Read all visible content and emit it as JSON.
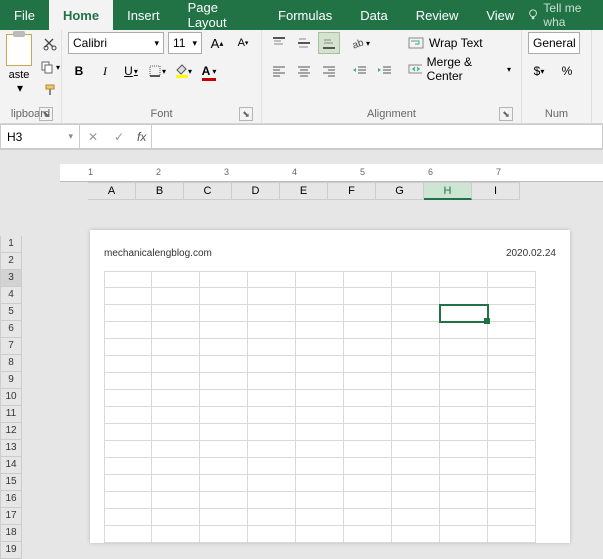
{
  "tabs": {
    "file": "File",
    "home": "Home",
    "insert": "Insert",
    "page_layout": "Page Layout",
    "formulas": "Formulas",
    "data": "Data",
    "review": "Review",
    "view": "View",
    "tellme": "Tell me wha"
  },
  "ribbon": {
    "clipboard": {
      "label": "lipboard",
      "paste": "aste"
    },
    "font": {
      "label": "Font",
      "name": "Calibri",
      "size": "11"
    },
    "alignment": {
      "label": "Alignment",
      "wrap": "Wrap Text",
      "merge": "Merge & Center"
    },
    "number": {
      "label": "Num",
      "format": "General",
      "currency": "$",
      "percent": "%"
    }
  },
  "formula_bar": {
    "name_box": "H3",
    "fx": "fx",
    "value": ""
  },
  "sheet": {
    "columns": [
      "A",
      "B",
      "C",
      "D",
      "E",
      "F",
      "G",
      "H",
      "I"
    ],
    "selected_col": "H",
    "selected_row": 3,
    "row_start": 1,
    "row_end": 19,
    "header_left": "mechanicalengblog.com",
    "header_right": "2020.02.24"
  },
  "ruler_marks": [
    "1",
    "2",
    "3",
    "4",
    "5",
    "6",
    "7"
  ]
}
